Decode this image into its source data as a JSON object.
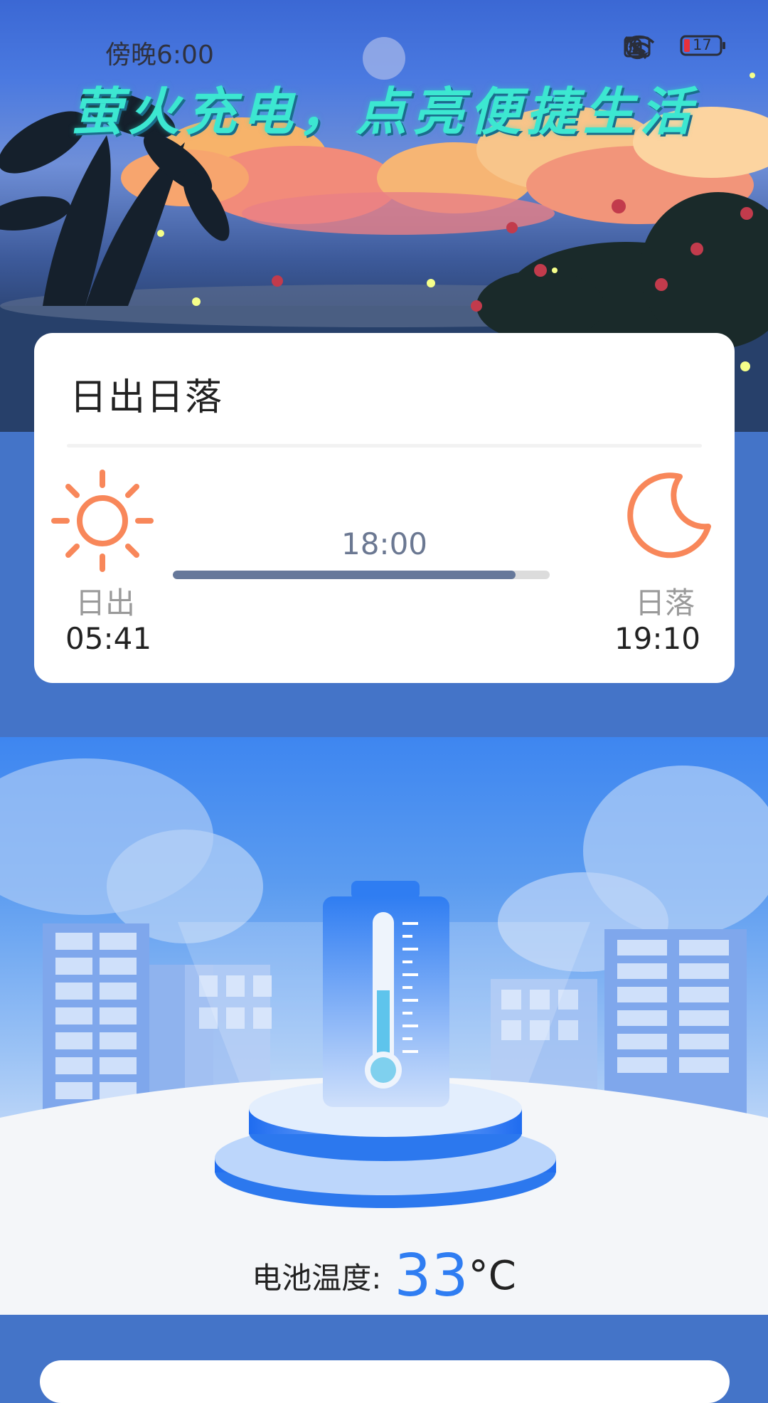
{
  "status_bar": {
    "time": "傍晚6:00",
    "battery_level": "17",
    "icons": [
      "moon-icon",
      "bell-off-icon",
      "sim-x-icon",
      "wifi-icon",
      "battery-icon"
    ]
  },
  "hero": {
    "slogan": "萤火充电，点亮便捷生活"
  },
  "sun_card": {
    "title": "日出日落",
    "sunrise_label": "日出",
    "sunrise_time": "05:41",
    "sunset_label": "日落",
    "sunset_time": "19:10",
    "current_time": "18:00",
    "progress": 0.91
  },
  "battery": {
    "label": "电池温度:",
    "value": "33",
    "unit": "°C"
  },
  "colors": {
    "accent": "#2f7df2",
    "sun_icon": "#f8875a",
    "progress_fill": "#66789a",
    "slogan": "#3ce7d1"
  }
}
